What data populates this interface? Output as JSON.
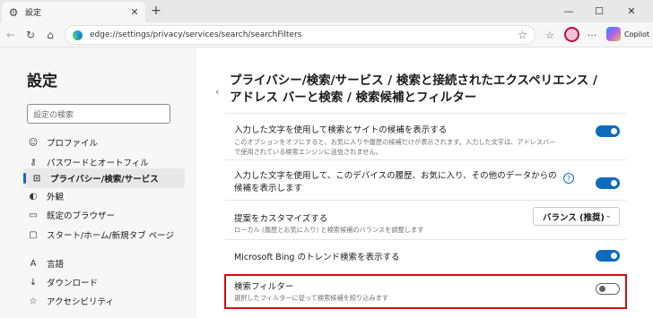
{
  "tab": {
    "title": "設定",
    "icon": "gear-icon"
  },
  "window": {
    "minimize": "—",
    "maximize": "☐",
    "close": "✕"
  },
  "toolbar": {
    "url": "edge://settings/privacy/services/search/searchFilters",
    "copilot_label": "Copilot"
  },
  "sidebar": {
    "title": "設定",
    "search_placeholder": "設定の検索",
    "items": [
      {
        "label": "プロファイル",
        "icon": "profile-icon",
        "glyph": "👤"
      },
      {
        "label": "パスワードとオートフィル",
        "icon": "key-icon",
        "glyph": "⚷"
      },
      {
        "label": "プライバシー/検索/サービス",
        "icon": "lock-icon",
        "glyph": "🔒",
        "selected": true
      },
      {
        "label": "外観",
        "icon": "appearance-icon",
        "glyph": "◐"
      },
      {
        "label": "既定のブラウザー",
        "icon": "browser-icon",
        "glyph": "▭"
      },
      {
        "label": "スタート/ホーム/新規タブ ページ",
        "icon": "home-icon",
        "glyph": "▢"
      },
      {
        "label": "言語",
        "icon": "language-icon",
        "glyph": "A"
      },
      {
        "label": "ダウンロード",
        "icon": "download-icon",
        "glyph": "↓"
      },
      {
        "label": "アクセシビリティ",
        "icon": "accessibility-icon",
        "glyph": "☆"
      }
    ]
  },
  "main": {
    "title_line1": "プライバシー/検索/サービス / 検索と接続されたエクスペリエンス /",
    "title_line2": "アドレス バーと検索 / 検索候補とフィルター",
    "settings": [
      {
        "title": "入力した文字を使用して検索とサイトの候補を表示する",
        "desc_line1": "このオプションをオフにすると、お気に入りや履歴の候補だけが表示されます。入力した文字は、アドレスバー",
        "desc_line2": "で使用されている検索エンジンに送信されません。",
        "enabled": true
      },
      {
        "title_line1": "入力した文字を使用して、このデバイスの履歴、お気に入り、その他のデータからの",
        "title_line2": "候補を表示します",
        "enabled": true
      },
      {
        "title": "提案をカスタマイズする",
        "desc": "ローカル (履歴とお気に入り) と検索候補のバランスを調整します",
        "dropdown_value": "バランス (推奨)"
      },
      {
        "title": "Microsoft Bing のトレンド検索を表示する",
        "enabled": true
      },
      {
        "title": "検索フィルター",
        "desc": "選択したフィルターに従って検索候補を絞り込みます",
        "enabled": false
      }
    ]
  },
  "colors": {
    "accent": "#0f6cbd",
    "highlight": "#d40d12"
  }
}
